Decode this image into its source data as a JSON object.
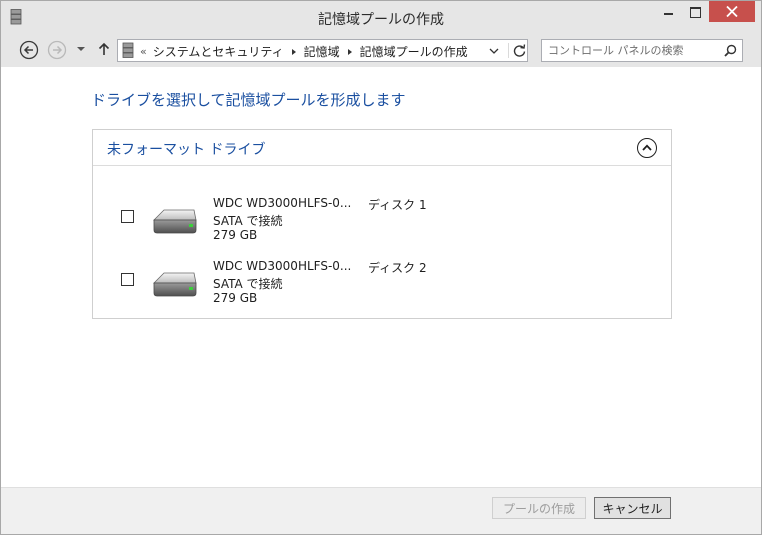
{
  "window": {
    "title": "記憶域プールの作成"
  },
  "nav": {
    "breadcrumb": [
      "システムとセキュリティ",
      "記憶域",
      "記憶域プールの作成"
    ],
    "search_placeholder": "コントロール パネルの検索"
  },
  "main": {
    "heading": "ドライブを選択して記憶域プールを形成します",
    "panel_title": "未フォーマット ドライブ",
    "drives": [
      {
        "name": "WDC WD3000HLFS-0...",
        "disk": "ディスク 1",
        "connection": "SATA で接続",
        "size": "279 GB",
        "checked": false
      },
      {
        "name": "WDC WD3000HLFS-0...",
        "disk": "ディスク 2",
        "connection": "SATA で接続",
        "size": "279 GB",
        "checked": false
      }
    ]
  },
  "footer": {
    "create_label": "プールの作成",
    "cancel_label": "キャンセル"
  },
  "colors": {
    "heading_blue": "#1a4fa0",
    "close_red": "#c7504c"
  }
}
